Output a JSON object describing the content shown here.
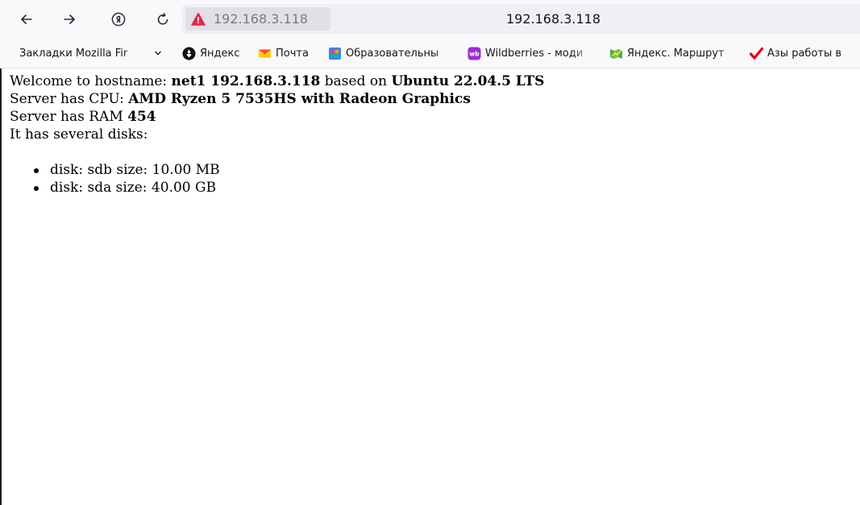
{
  "toolbar": {
    "url_host": "192.168.3.118",
    "page_title": "192.168.3.118"
  },
  "bookmarks": [
    {
      "label": "Закладки Mozilla Fir",
      "icon": "folder-icon"
    },
    {
      "label": "Яндекс",
      "icon": "yandex-icon"
    },
    {
      "label": "Почта",
      "icon": "mail-icon"
    },
    {
      "label": "Образовательны",
      "icon": "education-icon"
    },
    {
      "label": "Wildberries - моди",
      "icon": "wildberries-icon"
    },
    {
      "label": "Яндекс. Маршрут",
      "icon": "yandex-maps-icon"
    },
    {
      "label": "Азы работы в",
      "icon": "checkmark-icon"
    }
  ],
  "page": {
    "line1": {
      "prefix": "Welcome to hostname: ",
      "hostname": "net1 192.168.3.118",
      "middle": " based on ",
      "os": "Ubuntu 22.04.5 LTS"
    },
    "line2": {
      "prefix": "Server has CPU: ",
      "cpu": "AMD Ryzen 5 7535HS with Radeon Graphics"
    },
    "line3": {
      "prefix": "Server has RAM ",
      "ram": "454"
    },
    "line4": "It has several disks:",
    "disks": [
      "disk: sdb size: 10.00 MB",
      "disk: sda size: 40.00 GB"
    ]
  }
}
